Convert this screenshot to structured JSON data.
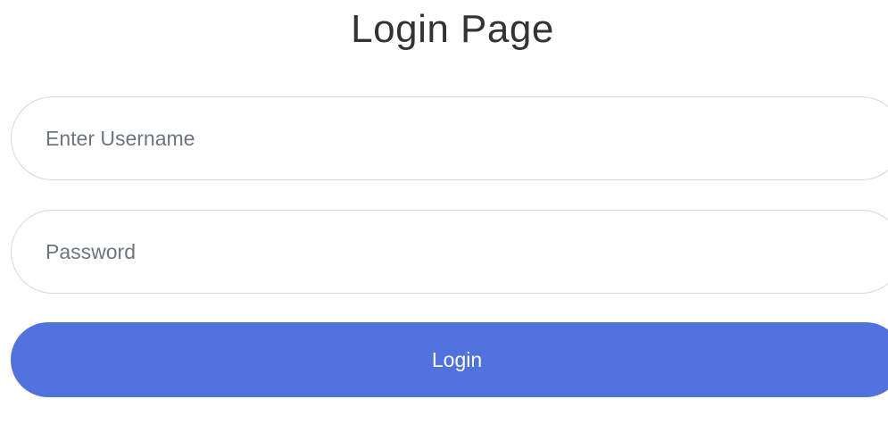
{
  "page": {
    "title": "Login Page"
  },
  "form": {
    "username": {
      "placeholder": "Enter Username",
      "value": ""
    },
    "password": {
      "placeholder": "Password",
      "value": ""
    },
    "login_label": "Login"
  },
  "colors": {
    "primary": "#4f72df",
    "border": "#d4d8e2",
    "placeholder": "#6f757e",
    "title": "#333333"
  }
}
